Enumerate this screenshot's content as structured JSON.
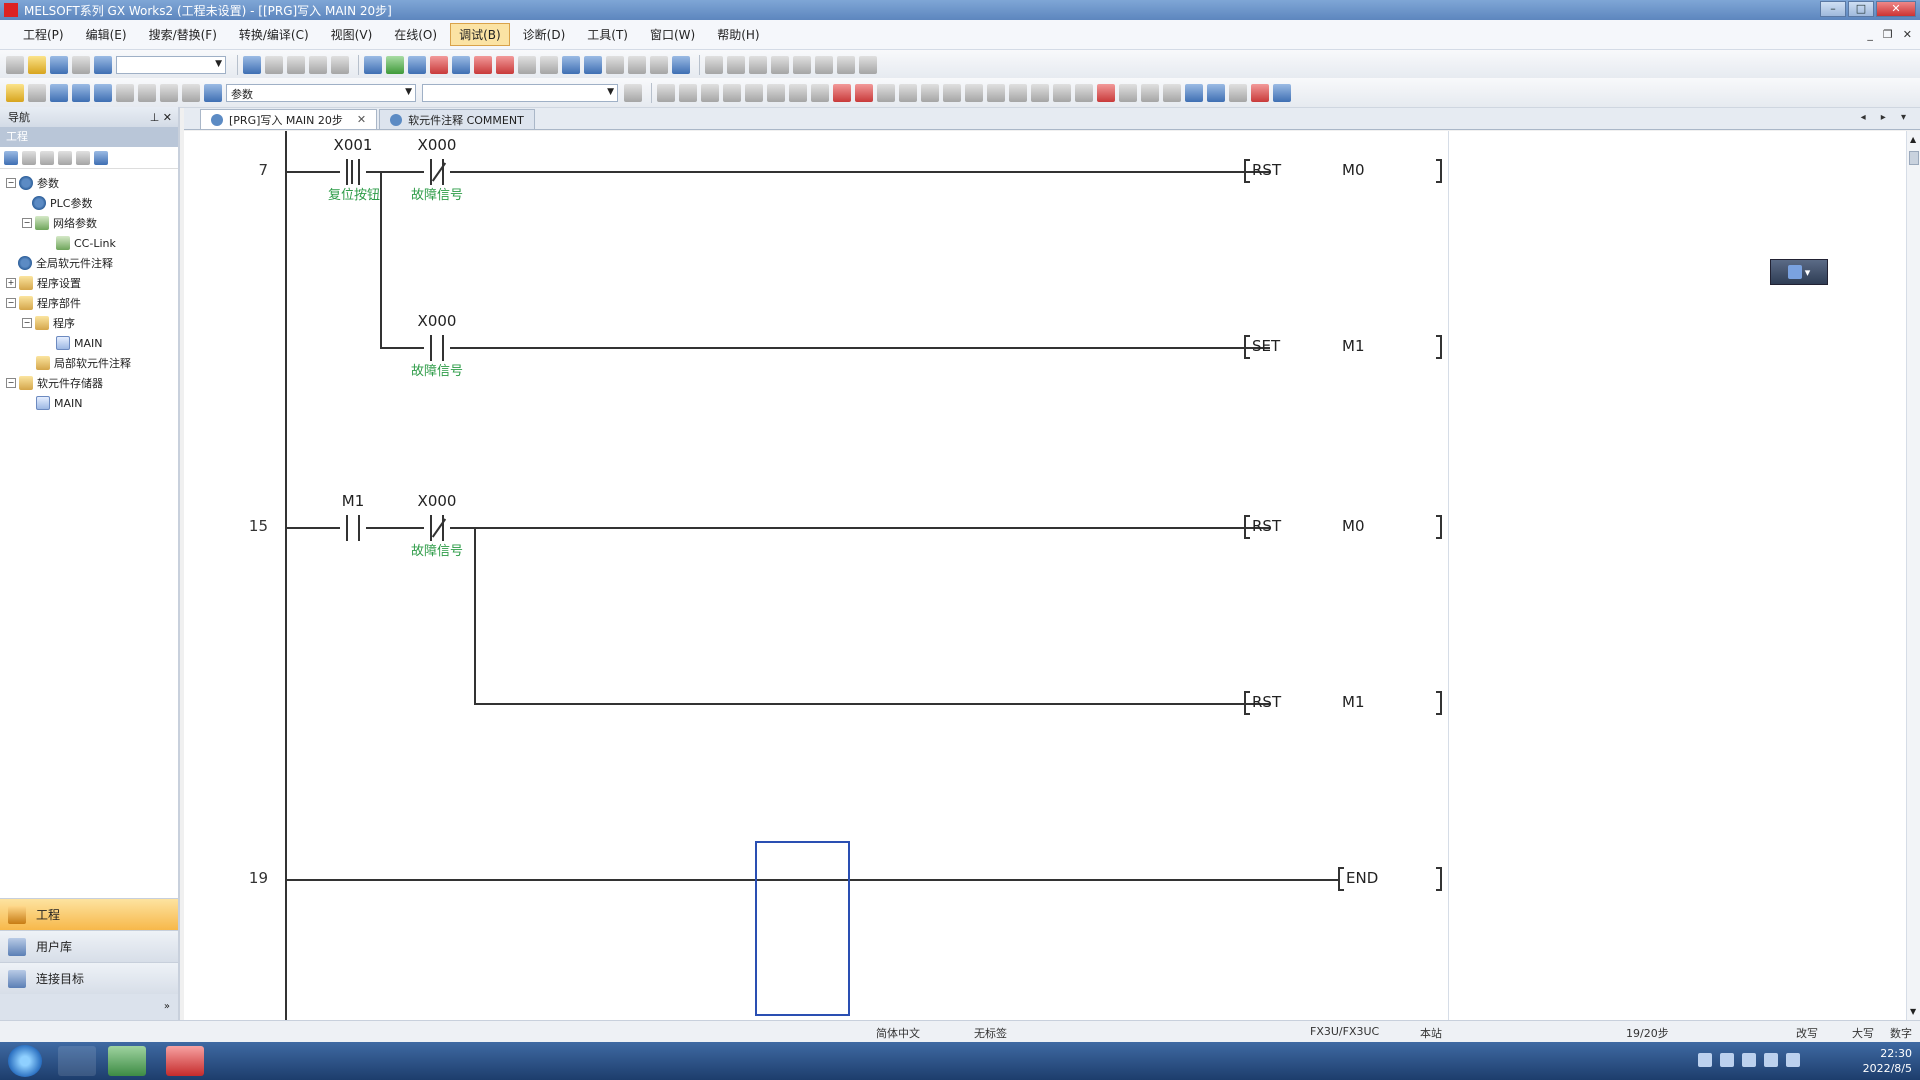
{
  "window": {
    "title": "MELSOFT系列 GX Works2 (工程未设置) - [[PRG]写入 MAIN 20步]"
  },
  "menu": [
    {
      "label": "工程(P)"
    },
    {
      "label": "编辑(E)"
    },
    {
      "label": "搜索/替换(F)"
    },
    {
      "label": "转换/编译(C)"
    },
    {
      "label": "视图(V)"
    },
    {
      "label": "在线(O)"
    },
    {
      "label": "调试(B)",
      "active": true
    },
    {
      "label": "诊断(D)"
    },
    {
      "label": "工具(T)"
    },
    {
      "label": "窗口(W)"
    },
    {
      "label": "帮助(H)"
    }
  ],
  "toolbar": {
    "combo_label": "参数"
  },
  "nav": {
    "title": "导航",
    "section": "工程",
    "tree": [
      {
        "label": "参数",
        "level": 0,
        "exp": "−",
        "icon": "gear"
      },
      {
        "label": "PLC参数",
        "level": 1,
        "exp": "",
        "icon": "gear"
      },
      {
        "label": "网络参数",
        "level": 1,
        "exp": "−",
        "icon": "net"
      },
      {
        "label": "CC-Link",
        "level": 2,
        "exp": "",
        "icon": "net"
      },
      {
        "label": "全局软元件注释",
        "level": 0,
        "exp": "",
        "icon": "gear"
      },
      {
        "label": "程序设置",
        "level": 0,
        "exp": "+",
        "icon": "folder"
      },
      {
        "label": "程序部件",
        "level": 0,
        "exp": "−",
        "icon": "folder"
      },
      {
        "label": "程序",
        "level": 1,
        "exp": "−",
        "icon": "folder"
      },
      {
        "label": "MAIN",
        "level": 2,
        "exp": "",
        "icon": "prog"
      },
      {
        "label": "局部软元件注释",
        "level": 1,
        "exp": "",
        "icon": "folder"
      },
      {
        "label": "软元件存储器",
        "level": 0,
        "exp": "−",
        "icon": "folder"
      },
      {
        "label": "MAIN",
        "level": 1,
        "exp": "",
        "icon": "prog"
      }
    ],
    "bottom_tabs": [
      {
        "label": "工程",
        "active": true
      },
      {
        "label": "用户库",
        "active": false
      },
      {
        "label": "连接目标",
        "active": false
      }
    ]
  },
  "tabs": [
    {
      "label": "[PRG]写入 MAIN 20步",
      "active": true
    },
    {
      "label": "软元件注释 COMMENT",
      "active": false
    }
  ],
  "ladder": {
    "steps": [
      "7",
      "15",
      "19"
    ],
    "rungs": [
      {
        "contacts": [
          {
            "device": "X001",
            "comment": "复位按钮",
            "type": "rising"
          },
          {
            "device": "X000",
            "comment": "故障信号",
            "type": "nc"
          }
        ],
        "instr": "RST",
        "operand": "M0"
      },
      {
        "contacts": [
          {
            "device": "X000",
            "comment": "故障信号",
            "type": "no"
          }
        ],
        "instr": "SET",
        "operand": "M1"
      },
      {
        "contacts": [
          {
            "device": "M1",
            "comment": "",
            "type": "no"
          },
          {
            "device": "X000",
            "comment": "故障信号",
            "type": "nc"
          }
        ],
        "instr": "RST",
        "operand": "M0"
      },
      {
        "contacts": [],
        "instr": "RST",
        "operand": "M1"
      },
      {
        "contacts": [],
        "instr": "END",
        "operand": ""
      }
    ]
  },
  "status": {
    "lang": "简体中文",
    "label": "无标签",
    "cpu": "FX3U/FX3UC",
    "station": "本站",
    "steps": "19/20步",
    "mode": "改写",
    "caps": "大写",
    "num": "数字"
  },
  "taskbar": {
    "time": "22:30",
    "date": "2022/8/5"
  }
}
